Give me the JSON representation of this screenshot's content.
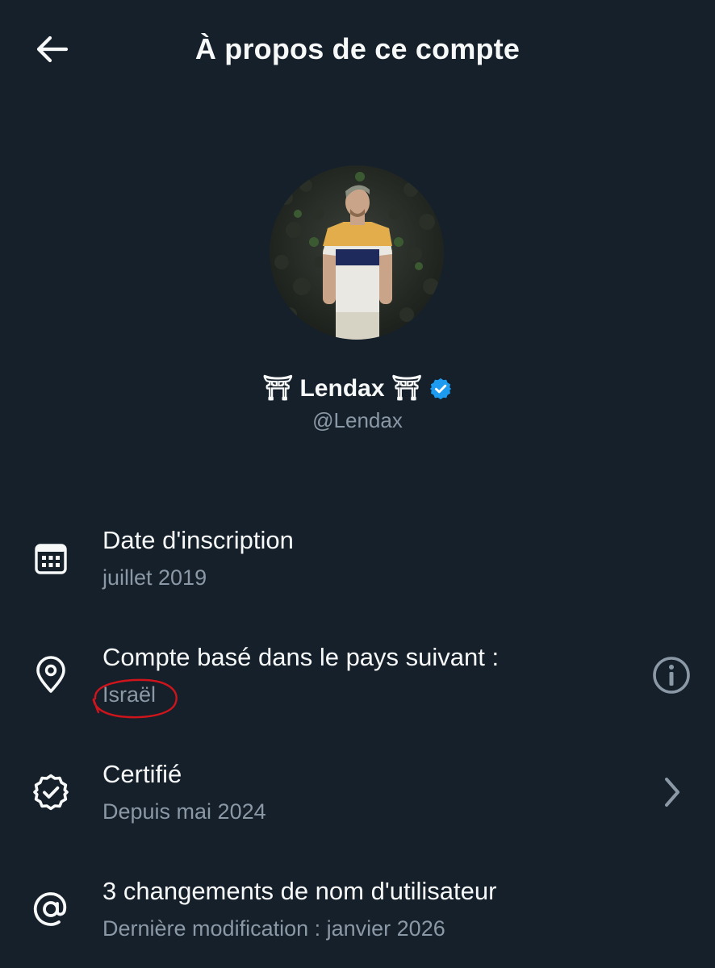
{
  "header": {
    "title": "À propos de ce compte"
  },
  "profile": {
    "display_name": "⛩ Lendax ⛩",
    "handle": "@Lendax",
    "verified": true
  },
  "rows": [
    {
      "icon": "calendar-icon",
      "title": "Date d'inscription",
      "subtitle": "juillet 2019"
    },
    {
      "icon": "location-pin-icon",
      "title": "Compte basé dans le pays suivant :",
      "subtitle": "Israël",
      "trailing_icon": "info-icon"
    },
    {
      "icon": "verified-badge-icon",
      "title": "Certifié",
      "subtitle": "Depuis mai 2024",
      "trailing_icon": "chevron-right-icon"
    },
    {
      "icon": "at-sign-icon",
      "title": "3 changements de nom d'utilisateur",
      "subtitle": "Dernière modification : janvier 2026"
    }
  ],
  "colors": {
    "background": "#15202b",
    "primary_text": "#f7f9f9",
    "secondary_text": "#8b98a5",
    "verified_blue": "#1d9bf0",
    "annotation_red": "#d0141b"
  }
}
